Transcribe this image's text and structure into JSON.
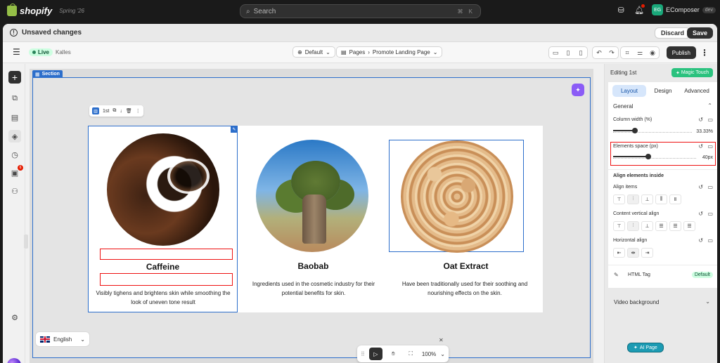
{
  "topbar": {
    "brand": "shopify",
    "edition": "Spring '26",
    "search_placeholder": "Search",
    "search_shortcut": "⌘ K",
    "store_initials": "EG",
    "store_name": "EComposer",
    "store_tag": "dev"
  },
  "unsaved": {
    "label": "Unsaved changes",
    "discard": "Discard",
    "save": "Save"
  },
  "toolbar": {
    "live": "Live",
    "theme": "Kalles",
    "template": "Default",
    "breadcrumb_root": "Pages",
    "breadcrumb_page": "Promote Landing Page",
    "publish": "Publish"
  },
  "canvas": {
    "section_label": "Section",
    "column_label": "1st",
    "products": [
      {
        "title": "Caffeine",
        "desc": "Visibly tighens and brightens skin while smoothing the look of uneven tone result"
      },
      {
        "title": "Baobab",
        "desc": "Ingredients used in the cosmetic industry for their potential benefits for skin."
      },
      {
        "title": "Oat Extract",
        "desc": "Have been traditionally used for their soothing and nourishing effects on the skin."
      }
    ],
    "language": "English",
    "zoom": "100%"
  },
  "panel": {
    "editing": "Editing 1st",
    "magic_touch": "Magic Touch",
    "tabs": [
      "Layout",
      "Design",
      "Advanced"
    ],
    "general": "General",
    "column_width_label": "Column width (%)",
    "column_width_value": "33.33%",
    "column_width_fraction": 0.28,
    "elements_space_label": "Elements space (px)",
    "elements_space_value": "40px",
    "elements_space_fraction": 0.42,
    "align_inside": "Align elements inside",
    "align_items": "Align items",
    "content_vertical_align": "Content vertical align",
    "horizontal_align": "Horizontal align",
    "html_tag": "HTML Tag",
    "html_tag_value": "Default",
    "video_background": "Video background",
    "ai_page": "AI Page"
  },
  "colors": {
    "accent": "#2c6ecb",
    "magic": "#2ac27e",
    "highlight": "#ee1111"
  }
}
